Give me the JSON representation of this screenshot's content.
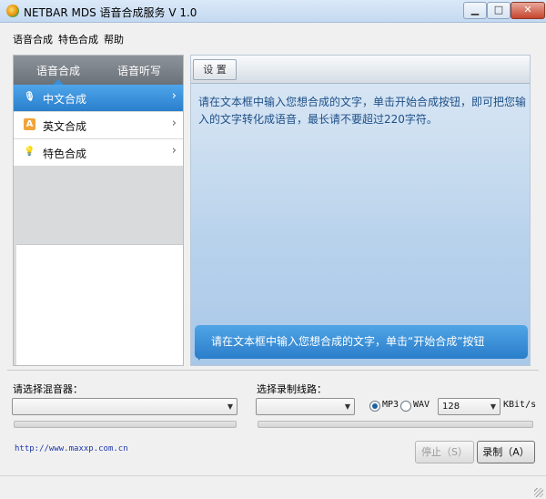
{
  "window": {
    "title": "NETBAR MDS 语音合成服务 V 1.0",
    "min_glyph": "▁",
    "max_glyph": "□",
    "close_glyph": "✕"
  },
  "menu": [
    "语音合成",
    "特色合成",
    "帮助"
  ],
  "left_tabs": [
    "语音合成",
    "语音听写"
  ],
  "nav": [
    {
      "label": "中文合成",
      "icon": "microphone-icon",
      "glyph": "🎙",
      "active": true
    },
    {
      "label": "英文合成",
      "icon": "letter-a-icon",
      "glyph": "A",
      "active": false
    },
    {
      "label": "特色合成",
      "icon": "lightbulb-icon",
      "glyph": "💡",
      "active": false
    }
  ],
  "chevron_glyph": "›",
  "settings_label": "设 置",
  "description": "请在文本框中输入您想合成的文字，单击开始合成按钮，即可把您输入的文字转化成语音，最长请不要超过220字符。",
  "callout": "请在文本框中输入您想合成的文字，单击“开始合成”按钮",
  "mixer": {
    "label": "请选择混音器：",
    "value": ""
  },
  "record_line": {
    "label": "选择录制线路：",
    "value": ""
  },
  "format": {
    "options": [
      "MP3",
      "WAV"
    ],
    "selected": "MP3"
  },
  "bitrate": {
    "value": "128",
    "unit": "KBit/s"
  },
  "website": "http://www.maxxp.com.cn",
  "buttons": {
    "stop": "停止（S）",
    "record": "录制（A）"
  },
  "colors": {
    "accent": "#2a7fcc",
    "link": "#1c37a8",
    "left_tabs": "#6b7178"
  }
}
